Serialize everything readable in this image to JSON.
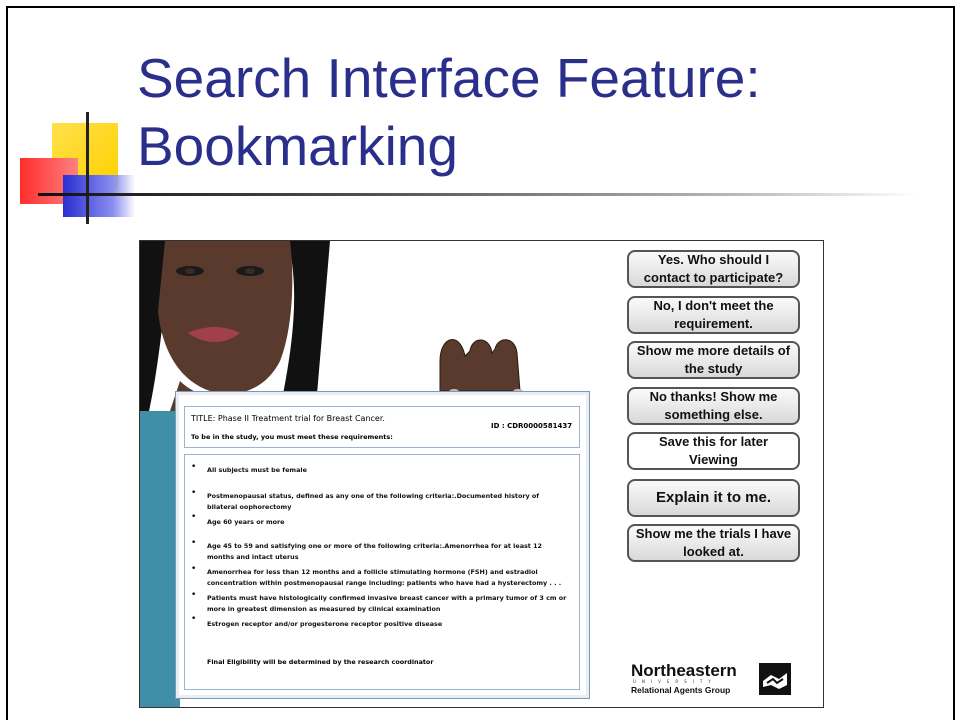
{
  "slide": {
    "title_line1": "Search Interface Feature:",
    "title_line2": "Bookmarking"
  },
  "screenshot": {
    "card": {
      "title": "TITLE: Phase II Treatment trial for Breast Cancer.",
      "id": "ID : CDR0000581437",
      "requirements_intro": "To be in the study, you must meet these requirements:",
      "criteria": [
        "All subjects must be female",
        "Postmenopausal status, defined as any one of the following criteria:.Documented history of bilateral oophorectomy",
        "Age 60 years or more",
        "Age 45 to 59 and satisfying one or more of the following criteria:.Amenorrhea for at least 12 months and intact uterus",
        "Amenorrhea for less than 12 months and a follicle stimulating hormone (FSH) and estradiol concentration within postmenopausal range including: patients who have had a hysterectomy . . .",
        "Patients must have histologically confirmed invasive breast cancer with a primary tumor of 3 cm or more in greatest dimension as measured by clinical examination",
        "Estrogen receptor and/or progesterone receptor positive disease"
      ],
      "final_note": "Final Eligibility will be determined by the research coordinator"
    },
    "buttons": [
      "Yes. Who should I contact to participate?",
      "No, I don't meet the requirement.",
      "Show me more details of the study",
      "No thanks! Show me something else.",
      "Save this for later Viewing",
      "Explain it to me.",
      "Show me the trials I have looked at."
    ],
    "logo": {
      "name": "Northeastern",
      "university": "UNIVERSITY",
      "group": "Relational Agents Group"
    }
  },
  "colors": {
    "title": "#2b2f8c",
    "skin": "#5a3a2c",
    "hair": "#111111",
    "shirt": "#3f8fa8"
  }
}
